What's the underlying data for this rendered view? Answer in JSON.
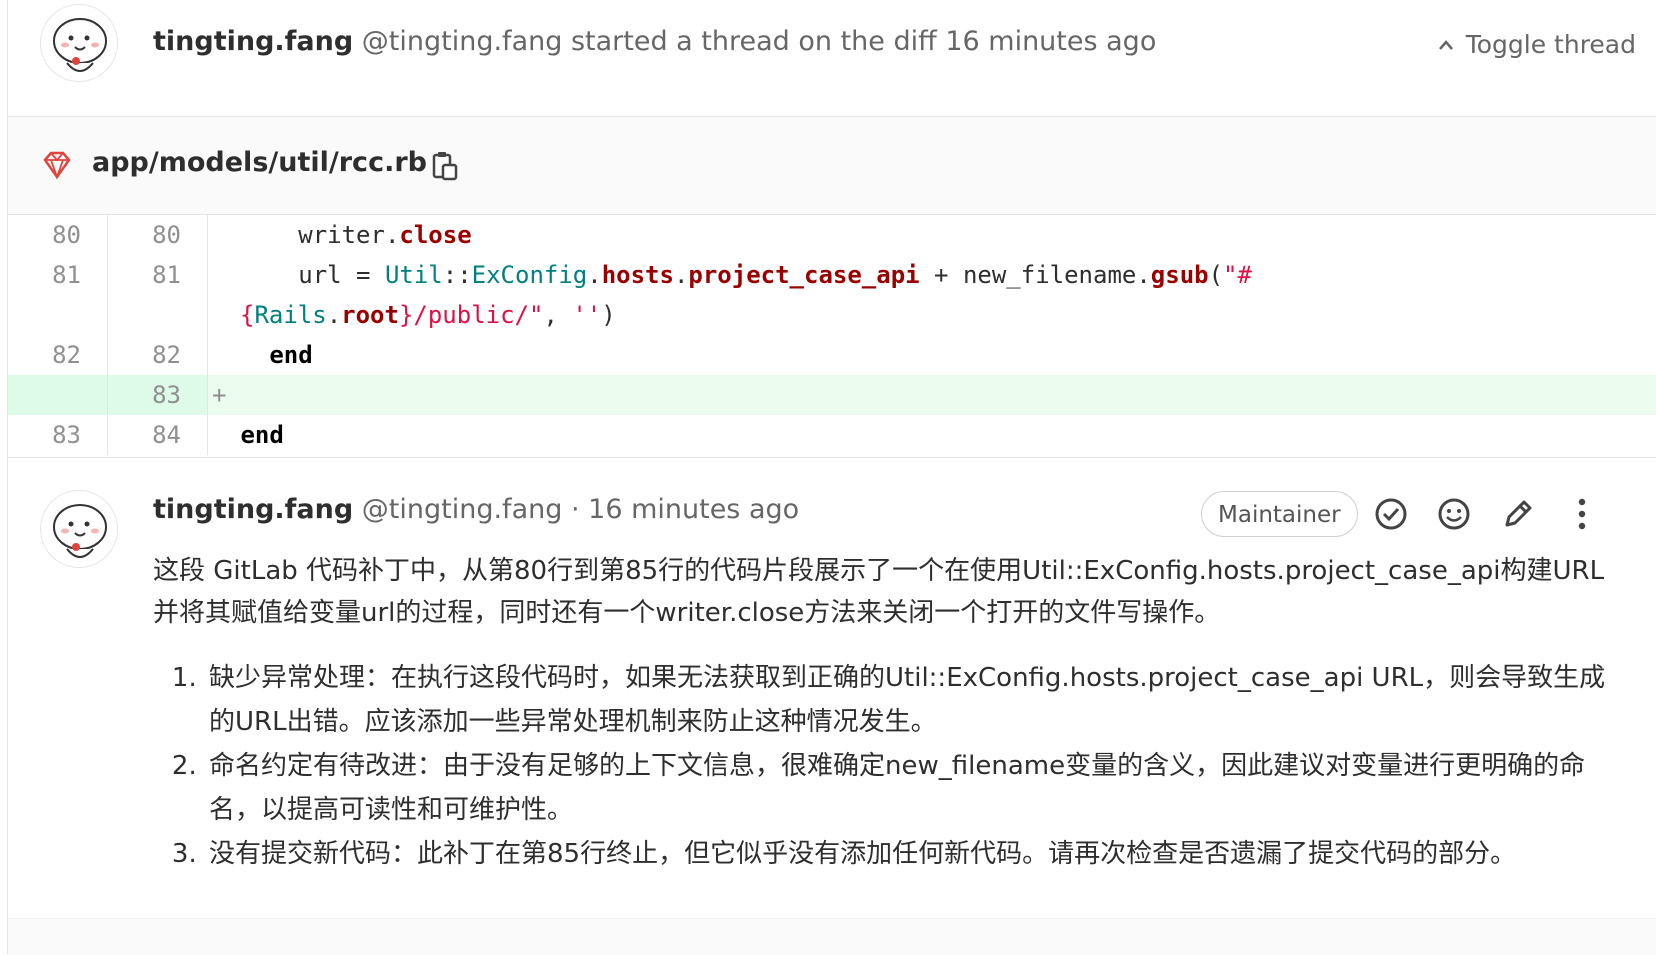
{
  "thread": {
    "author_name": "tingting.fang",
    "author_handle": "@tingting.fang",
    "action_text": "started a thread on the diff",
    "time_ago": "16 minutes ago",
    "toggle_label": "Toggle thread"
  },
  "file": {
    "path": "app/models/util/rcc.rb",
    "icon": "ruby-gem-icon"
  },
  "diff": {
    "rows": [
      {
        "old": "80",
        "new": "80"
      },
      {
        "old": "81",
        "new": "81"
      },
      {
        "old": "",
        "new": ""
      },
      {
        "old": "82",
        "new": "82"
      },
      {
        "old": "",
        "new": "83",
        "marker": "+"
      },
      {
        "old": "83",
        "new": "84"
      }
    ],
    "tokens": {
      "writer": "writer",
      "dot": ".",
      "close": "close",
      "url_assign": "url = ",
      "util": "Util",
      "colons": "::",
      "exconfig": "ExConfig",
      "hosts": "hosts",
      "project_case_api": "project_case_api",
      "plus": " + ",
      "new_filename": "new_filename",
      "gsub": "gsub",
      "paren_open": "(",
      "str_open": "\"#",
      "brace_open": "{",
      "rails": "Rails",
      "root": "root",
      "brace_close": "}",
      "str_path": "/public/\"",
      "comma": ", ",
      "empty_str": "''",
      "paren_close": ")",
      "end": "end"
    }
  },
  "note": {
    "author_name": "tingting.fang",
    "author_handle": "@tingting.fang",
    "separator": "·",
    "time_ago": "16 minutes ago",
    "role_badge": "Maintainer",
    "intro": "这段 GitLab 代码补丁中，从第80行到第85行的代码片段展示了一个在使用Util::ExConfig.hosts.project_case_api构建URL并将其赋值给变量url的过程，同时还有一个writer.close方法来关闭一个打开的文件写操作。",
    "items": [
      "缺少异常处理：在执行这段代码时，如果无法获取到正确的Util::ExConfig.hosts.project_case_api URL，则会导致生成的URL出错。应该添加一些异常处理机制来防止这种情况发生。",
      "命名约定有待改进：由于没有足够的上下文信息，很难确定new_filename变量的含义，因此建议对变量进行更明确的命名，以提高可读性和可维护性。",
      "没有提交新代码：此补丁在第85行终止，但它似乎没有添加任何新代码。请再次检查是否遗漏了提交代码的部分。"
    ],
    "actions": [
      "resolve-thread-icon",
      "emoji-icon",
      "pencil-icon",
      "kebab-menu-icon"
    ]
  }
}
